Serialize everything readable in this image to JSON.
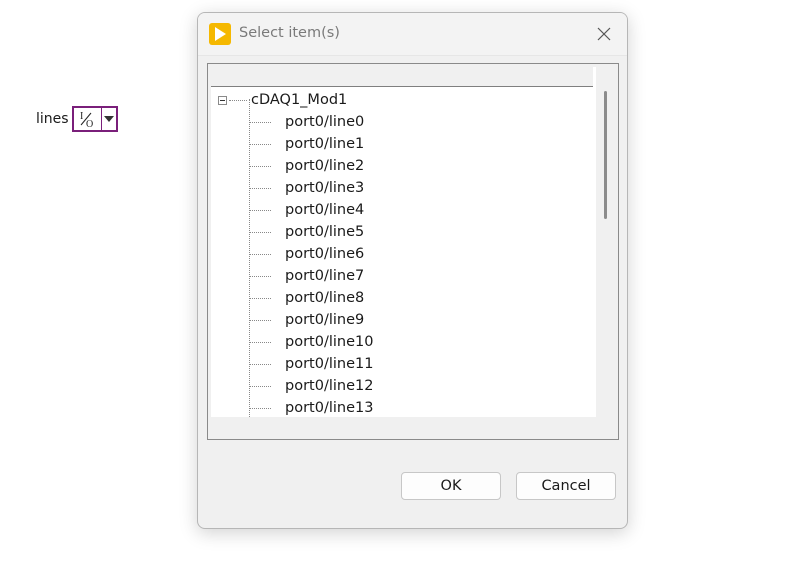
{
  "front_panel": {
    "lines_label": "lines",
    "io_control_icon": "io-name-icon",
    "dropdown_icon": "dropdown-arrow-icon",
    "accent_color": "#7a1f7a"
  },
  "dialog": {
    "title": "Select item(s)",
    "app_icon": "labview-run-icon",
    "close_icon": "close-icon",
    "tree": {
      "root": "cDAQ1_Mod1",
      "items": [
        "port0/line0",
        "port0/line1",
        "port0/line2",
        "port0/line3",
        "port0/line4",
        "port0/line5",
        "port0/line6",
        "port0/line7",
        "port0/line8",
        "port0/line9",
        "port0/line10",
        "port0/line11",
        "port0/line12",
        "port0/line13"
      ]
    },
    "buttons": {
      "ok": "OK",
      "cancel": "Cancel"
    }
  }
}
